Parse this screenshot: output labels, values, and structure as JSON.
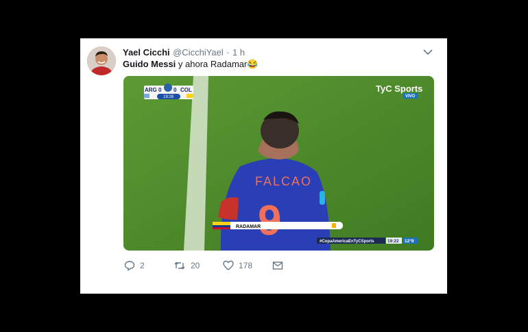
{
  "tweet": {
    "author_name": "Yael Cicchi",
    "handle": "@CicchiYael",
    "separator": "·",
    "time": "1 h",
    "text_bold": "Guido Messi",
    "text_rest": " y ahora Radamar",
    "emoji": "😂"
  },
  "media": {
    "scoreboard": {
      "team1": "ARG",
      "score1": "0",
      "score2": "0",
      "team2": "COL",
      "clock": "19:28"
    },
    "broadcaster": "TyC Sports",
    "live_label": "VIVO",
    "jersey_name": "FALCAO",
    "jersey_number": "9",
    "lower_third_name": "RADAMAR",
    "hashtag": "#CopaAmericaEnTyCSports",
    "time_box": "19:22",
    "temp_box": "12°9"
  },
  "actions": {
    "reply_count": "2",
    "retweet_count": "20",
    "like_count": "178"
  },
  "colors": {
    "twitter_gray": "#657786",
    "pitch_green": "#4e8a2a",
    "jersey_blue": "#2a3fb5",
    "jersey_number": "#f0705a"
  }
}
